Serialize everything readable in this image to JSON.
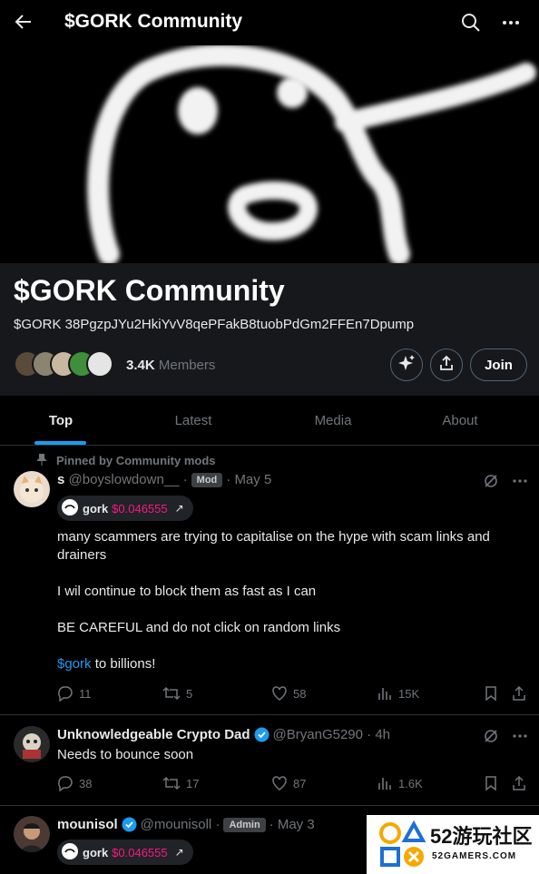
{
  "topbar": {
    "title": "$GORK Community"
  },
  "community": {
    "name": "$GORK Community",
    "description": "$GORK 38PgzpJYu2HkiYvV8qePFakB8tuobPdGm2FFEn7Dpump",
    "members_count": "3.4K",
    "members_label": "Members",
    "join_label": "Join"
  },
  "tabs": [
    {
      "label": "Top",
      "active": true
    },
    {
      "label": "Latest",
      "active": false
    },
    {
      "label": "Media",
      "active": false
    },
    {
      "label": "About",
      "active": false
    }
  ],
  "pinned_label": "Pinned by Community mods",
  "posts": [
    {
      "display_name": "s",
      "handle": "@boyslowdown__",
      "badge": "Mod",
      "time": "May 5",
      "ticker": {
        "name": "gork",
        "price": "$0.046555",
        "arrow": "↗"
      },
      "lines": [
        "many scammers are trying to capitalise on the hype with scam links and drainers",
        "I wil continue to block them as fast as I can",
        "BE CAREFUL and do not click on random links"
      ],
      "cashtag": "$gork",
      "cashtag_rest": " to billions!",
      "replies": "11",
      "reposts": "5",
      "likes": "58",
      "views": "15K"
    },
    {
      "display_name": "Unknowledgeable Crypto Dad",
      "handle": "@BryanG5290",
      "time": "4h",
      "text": "Needs to bounce soon",
      "replies": "38",
      "reposts": "17",
      "likes": "87",
      "views": "1.6K"
    },
    {
      "display_name": "mounisol",
      "handle": "@mounisoll",
      "badge": "Admin",
      "time": "May 3",
      "ticker": {
        "name": "gork",
        "price": "$0.046555",
        "arrow": "↗"
      }
    }
  ],
  "icons": {
    "back": "arrow-left-icon",
    "search": "search-icon",
    "more": "more-icon",
    "grok": "sparkle-icon",
    "share": "share-icon",
    "reply": "reply-icon",
    "repost": "repost-icon",
    "like": "heart-icon",
    "views": "views-icon",
    "bookmark": "bookmark-icon",
    "verified": "verified-badge-icon",
    "pin": "pin-icon"
  },
  "colors": {
    "accent": "#1d9bf0",
    "price": "#f91880",
    "background": "#000000",
    "panel": "#16181c",
    "muted": "#71767b"
  },
  "watermark": {
    "main": "52游玩社区",
    "sub": "52GAMERS.COM"
  }
}
